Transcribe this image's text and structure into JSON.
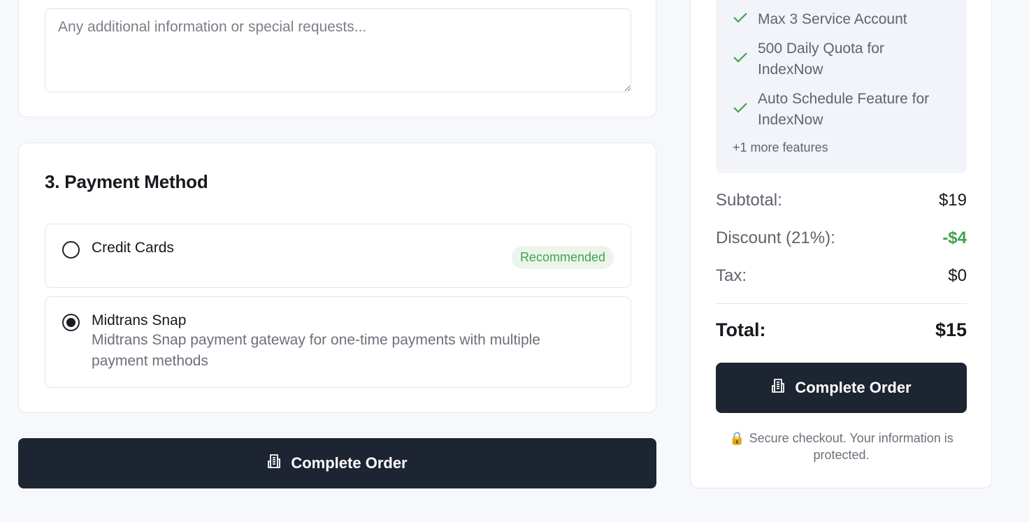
{
  "notes": {
    "placeholder": "Any additional information or special requests..."
  },
  "payment": {
    "title": "3. Payment Method",
    "options": [
      {
        "label": "Credit Cards",
        "badge": "Recommended",
        "selected": false
      },
      {
        "label": "Midtrans Snap",
        "description": "Midtrans Snap payment gateway for one-time payments with multiple payment methods",
        "selected": true
      }
    ]
  },
  "main_button": {
    "label": "Complete Order",
    "icon": "receipt-icon"
  },
  "summary": {
    "features": [
      "Max 3 Service Account",
      "500 Daily Quota for IndexNow",
      "Auto Schedule Feature for IndexNow"
    ],
    "more_features": "+1 more features",
    "subtotal_label": "Subtotal:",
    "subtotal_value": "$19",
    "discount_label": "Discount (21%):",
    "discount_value": "-$4",
    "tax_label": "Tax:",
    "tax_value": "$0",
    "total_label": "Total:",
    "total_value": "$15",
    "button_label": "Complete Order",
    "secure_icon": "lock-icon",
    "secure_text": "Secure checkout. Your information is protected."
  },
  "colors": {
    "primary_button": "#1d2432",
    "accent_green": "#3fa34d",
    "page_bg": "#f7f8fb"
  }
}
